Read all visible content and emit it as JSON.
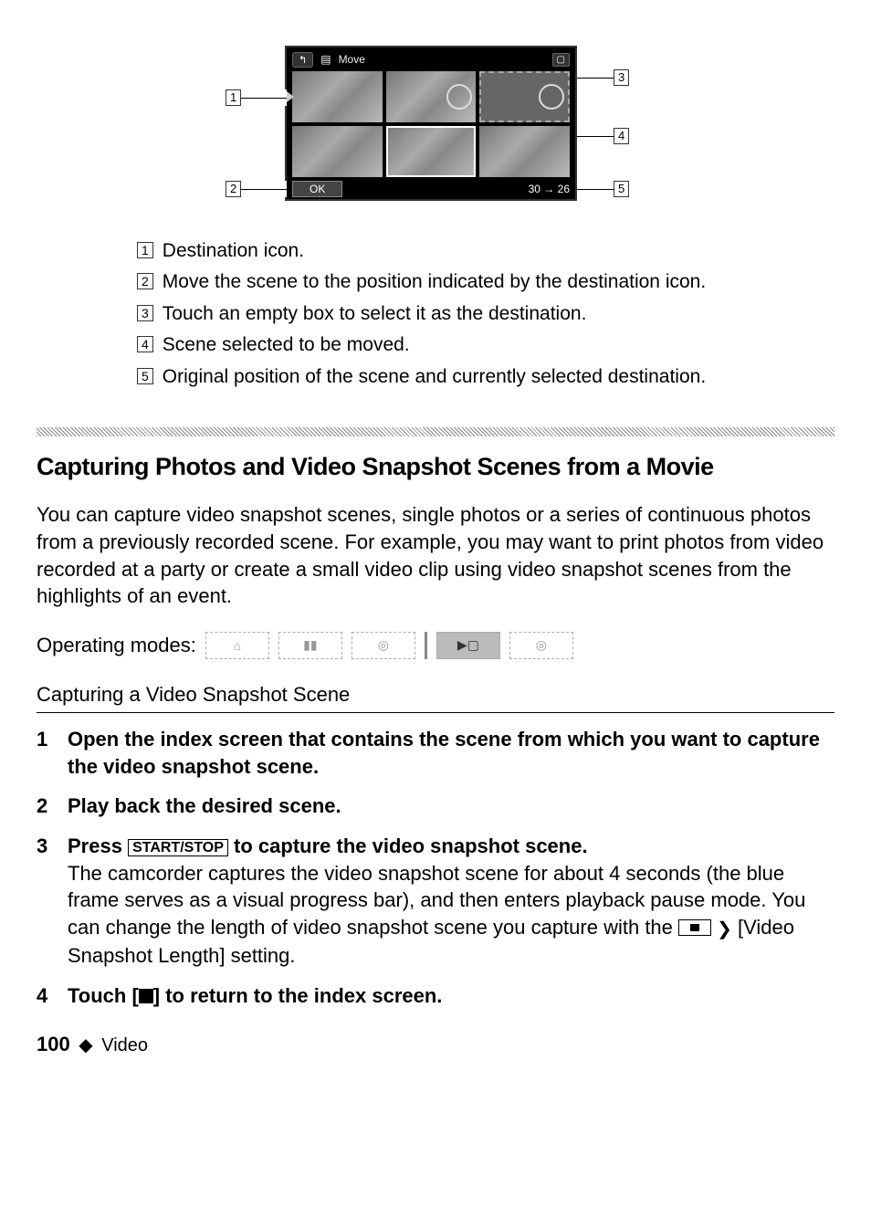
{
  "figure": {
    "topbar": {
      "back_glyph": "↰",
      "move_label": "Move",
      "cam_glyph": "▢"
    },
    "bottom": {
      "ok_label": "OK",
      "pos_from": "30",
      "pos_arrow": "→",
      "pos_to": "26"
    },
    "callouts": {
      "c1": "1",
      "c2": "2",
      "c3": "3",
      "c4": "4",
      "c5": "5"
    }
  },
  "legend": {
    "items": [
      {
        "num": "1",
        "text": "Destination icon."
      },
      {
        "num": "2",
        "text": "Move the scene to the position indicated by the destination icon."
      },
      {
        "num": "3",
        "text": "Touch an empty box to select it as the destination."
      },
      {
        "num": "4",
        "text": "Scene selected to be moved."
      },
      {
        "num": "5",
        "text": "Original position of the scene and currently selected destination."
      }
    ]
  },
  "section": {
    "title": "Capturing Photos and Video Snapshot Scenes from a Movie",
    "intro": "You can capture video snapshot scenes, single photos or a series of continuous photos from a previously recorded scene. For example, you may want to print photos from video recorded at a party or create a small video clip using video snapshot scenes from the highlights of an event.",
    "opmodes_label": "Operating modes:"
  },
  "subsection": {
    "title": "Capturing a Video Snapshot Scene",
    "steps": [
      {
        "head": "Open the index screen that contains the scene from which you want to capture the video snapshot scene.",
        "body": ""
      },
      {
        "head": "Play back the desired scene.",
        "body": ""
      },
      {
        "head_before": "Press ",
        "key": "START/STOP",
        "head_after": " to capture the video snapshot scene.",
        "body_before": "The camcorder captures the video snapshot scene for about 4 seconds (the blue frame serves as a visual progress bar), and then enters playback pause mode. You can change the length of video snapshot scene you capture with the ",
        "body_after": " [Video Snapshot Length] setting."
      },
      {
        "head_before": "Touch [",
        "head_after": "] to return to the index screen.",
        "body": ""
      }
    ]
  },
  "footer": {
    "page_number": "100",
    "diamond": "◆",
    "section_name": "Video"
  },
  "icons": {
    "swirl": "❯"
  }
}
